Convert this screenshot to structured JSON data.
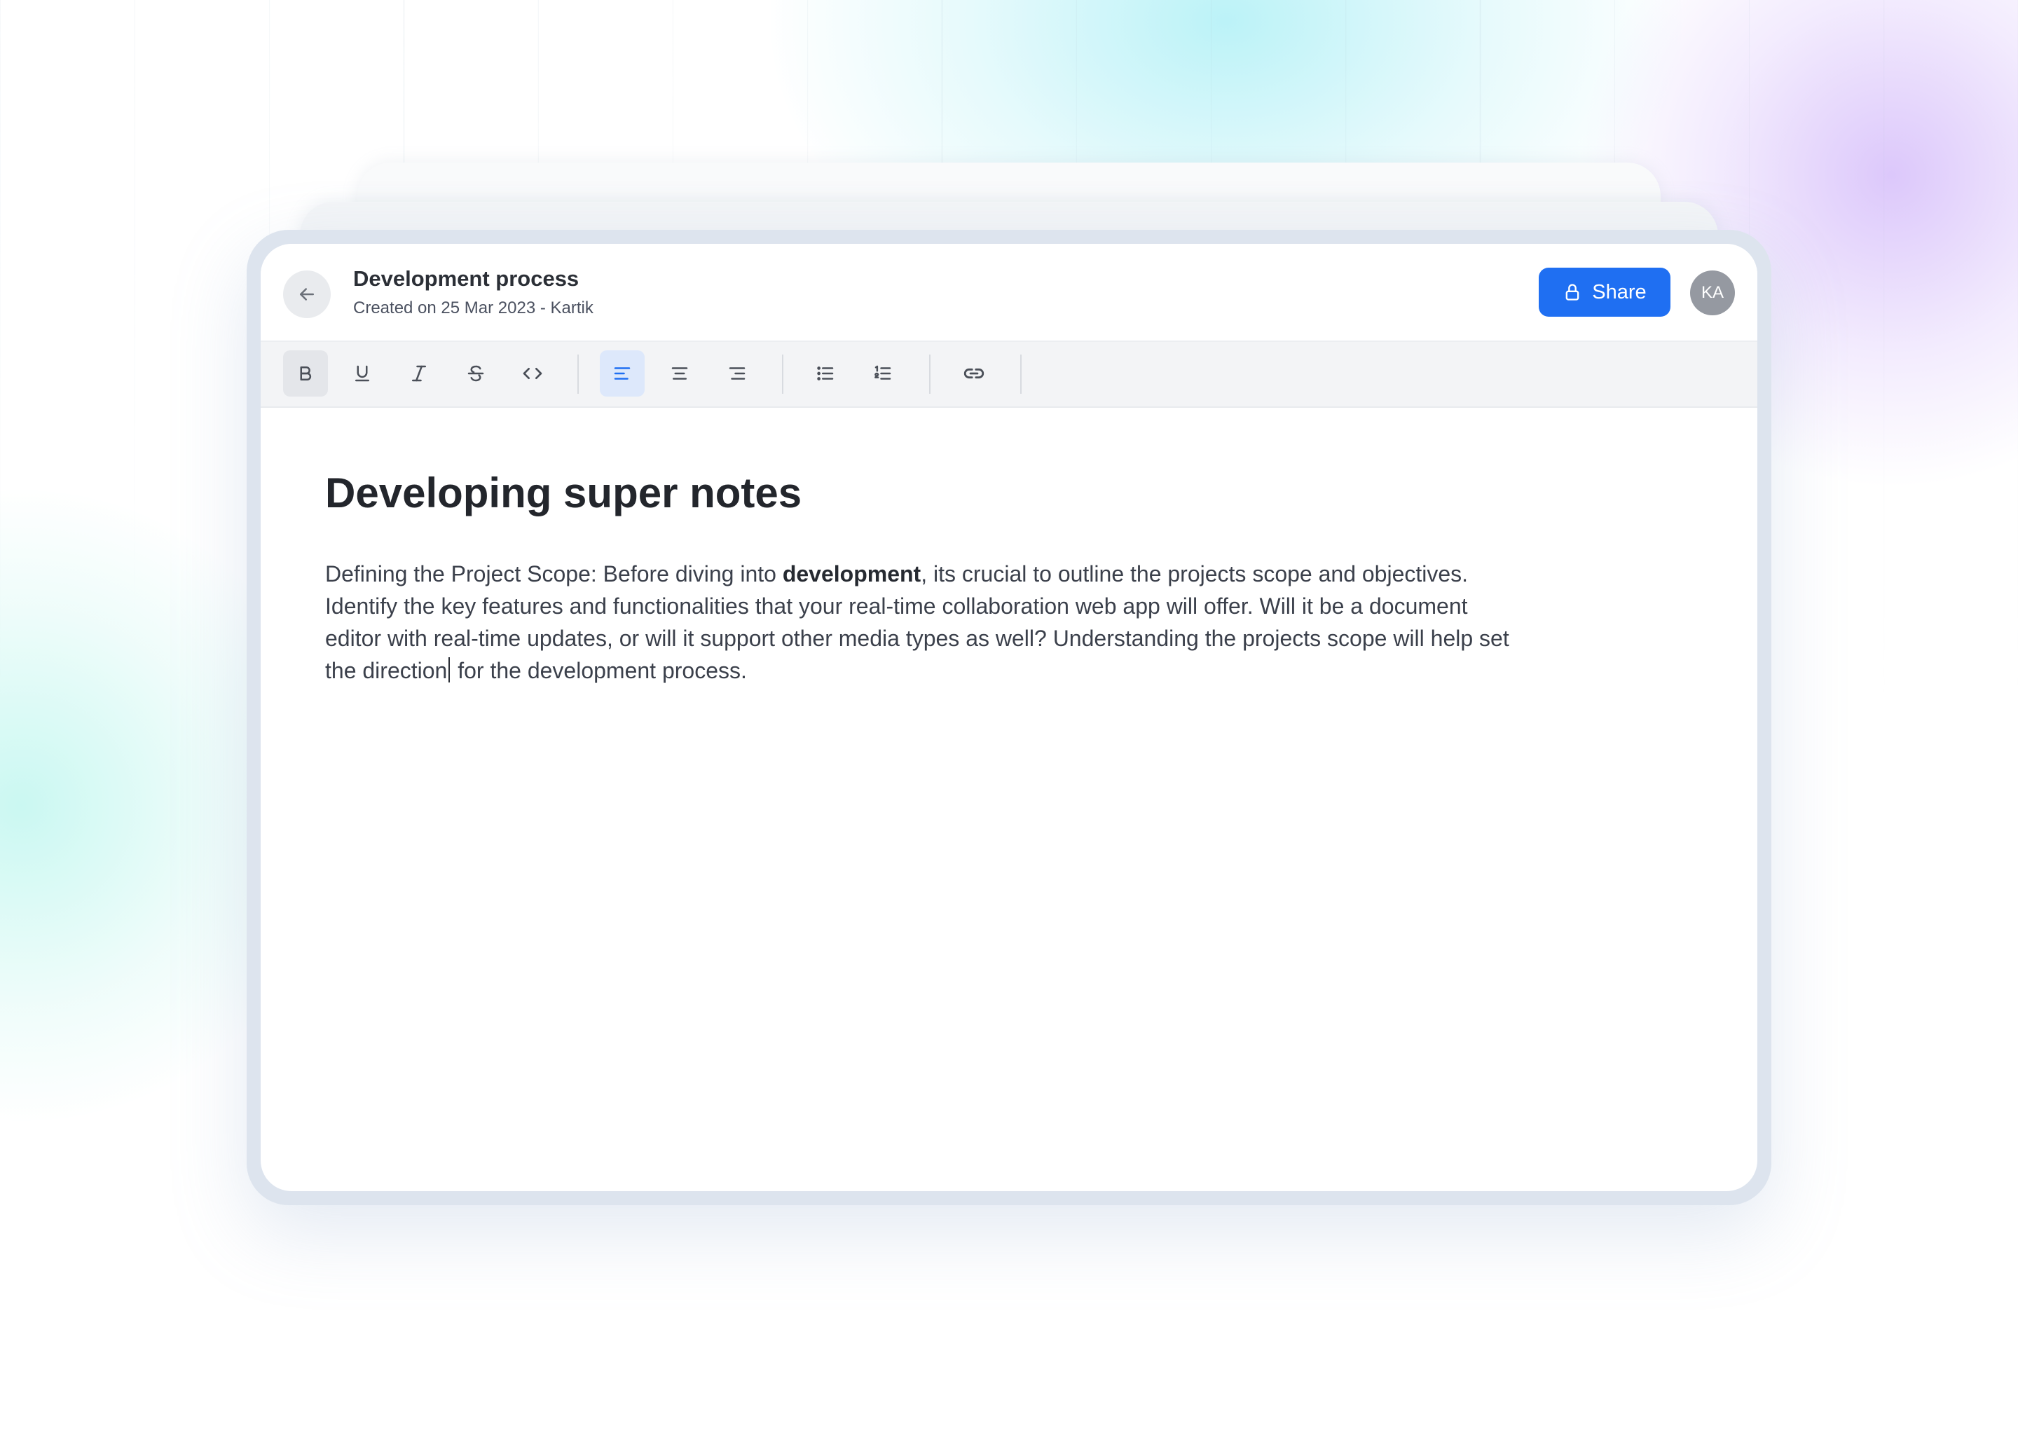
{
  "header": {
    "title": "Development process",
    "meta": "Created on 25 Mar 2023 - Kartik",
    "share_label": "Share",
    "avatar_initials": "KA"
  },
  "toolbar": {
    "formatting": [
      {
        "name": "bold",
        "icon": "bold-icon",
        "active": true
      },
      {
        "name": "underline",
        "icon": "underline-icon",
        "active": false
      },
      {
        "name": "italic",
        "icon": "italic-icon",
        "active": false
      },
      {
        "name": "strikethrough",
        "icon": "strikethrough-icon",
        "active": false
      },
      {
        "name": "code",
        "icon": "code-icon",
        "active": false
      }
    ],
    "alignment": [
      {
        "name": "align-left",
        "icon": "align-left-icon",
        "active": true
      },
      {
        "name": "align-center",
        "icon": "align-center-icon",
        "active": false
      },
      {
        "name": "align-right",
        "icon": "align-right-icon",
        "active": false
      }
    ],
    "lists": [
      {
        "name": "bulleted-list",
        "icon": "bulleted-list-icon",
        "active": false
      },
      {
        "name": "numbered-list",
        "icon": "numbered-list-icon",
        "active": false
      }
    ],
    "insert": [
      {
        "name": "link",
        "icon": "link-icon",
        "active": false
      }
    ]
  },
  "document": {
    "heading": "Developing super notes",
    "paragraph_before_bold": "Defining the Project Scope: Before diving into ",
    "paragraph_bold": "development",
    "paragraph_before_caret": ", its crucial to outline the projects scope and objectives. Identify the key features and functionalities that your real-time collaboration web app will offer. Will it be a document editor with real-time updates, or will it support other media types as well? Understanding the projects scope will help set the direction",
    "paragraph_after_caret": " for the development process."
  },
  "colors": {
    "accent": "#1f6ff2",
    "active_tool_bg": "#dde8fb",
    "avatar_bg": "#9599a1",
    "toolbar_bg": "#f3f4f6",
    "heading_text": "#23262c"
  }
}
